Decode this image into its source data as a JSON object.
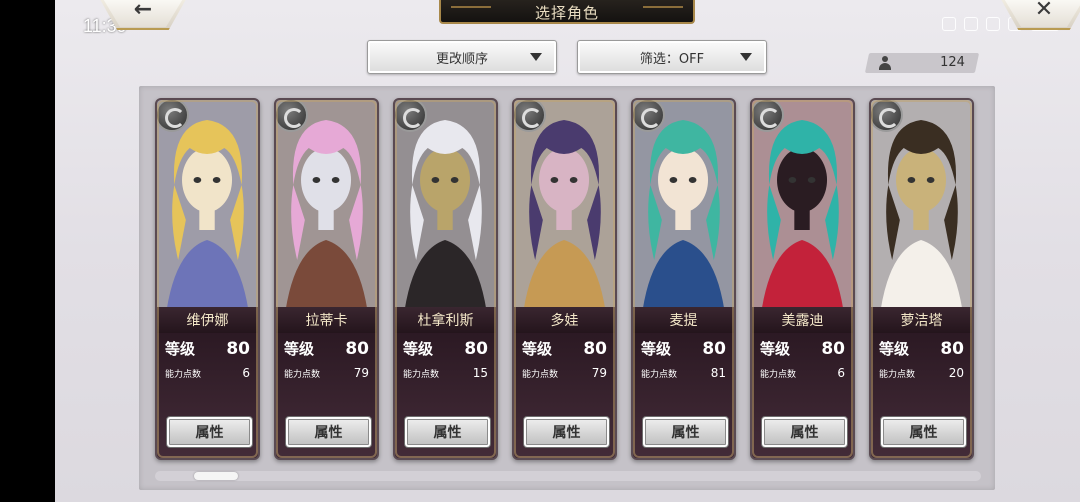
{
  "status_bar": {
    "time": "11:39"
  },
  "header": {
    "title": "选择角色",
    "back_glyph": "←",
    "close_glyph": "✕"
  },
  "toolbar": {
    "order_label": "更改顺序",
    "filter_label": "筛选：OFF",
    "count": "124"
  },
  "characters": [
    {
      "name": "维伊娜",
      "level_label": "等级",
      "level": "80",
      "points_label": "能力点数",
      "points": "6",
      "button": "属性",
      "colors": [
        "#e6c45a",
        "#6d74b8",
        "#f1e4c9"
      ]
    },
    {
      "name": "拉蒂卡",
      "level_label": "等级",
      "level": "80",
      "points_label": "能力点数",
      "points": "79",
      "button": "属性",
      "colors": [
        "#e6a9d6",
        "#7a4a3a",
        "#e0e0e8"
      ]
    },
    {
      "name": "杜拿利斯",
      "level_label": "等级",
      "level": "80",
      "points_label": "能力点数",
      "points": "15",
      "button": "属性",
      "colors": [
        "#e8e8ee",
        "#2b2628",
        "#b9a46a"
      ]
    },
    {
      "name": "多娃",
      "level_label": "等级",
      "level": "80",
      "points_label": "能力点数",
      "points": "79",
      "button": "属性",
      "colors": [
        "#4a3b6e",
        "#c69a54",
        "#d8b4c4"
      ]
    },
    {
      "name": "麦提",
      "level_label": "等级",
      "level": "80",
      "points_label": "能力点数",
      "points": "81",
      "button": "属性",
      "colors": [
        "#3fb6a1",
        "#2a4f8c",
        "#f2e4d4"
      ]
    },
    {
      "name": "美露迪",
      "level_label": "等级",
      "level": "80",
      "points_label": "能力点数",
      "points": "6",
      "button": "属性",
      "colors": [
        "#2fb3a8",
        "#c3223a",
        "#2a1c22"
      ]
    },
    {
      "name": "萝洁塔",
      "level_label": "等级",
      "level": "80",
      "points_label": "能力点数",
      "points": "20",
      "button": "属性",
      "colors": [
        "#3a2e22",
        "#f4f0ea",
        "#c9b27a"
      ]
    }
  ],
  "scrollbar": {
    "position": 0.05
  }
}
